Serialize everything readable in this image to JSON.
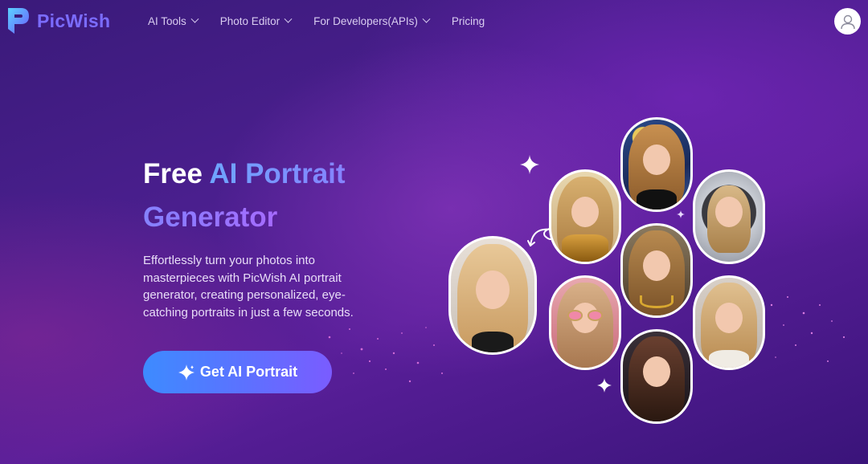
{
  "brand": {
    "name": "PicWish",
    "accent": "#7b6cff"
  },
  "nav": {
    "items": [
      {
        "label": "AI Tools",
        "dropdown": true
      },
      {
        "label": "Photo Editor",
        "dropdown": true
      },
      {
        "label": "For Developers(APIs)",
        "dropdown": true
      },
      {
        "label": "Pricing",
        "dropdown": false
      }
    ],
    "user_icon": "user-icon"
  },
  "hero": {
    "title_part1": "Free ",
    "title_part2": "AI Portrait Generator",
    "description": "Effortlessly turn your photos into masterpieces with PicWish AI portrait generator, creating personalized, eye-catching portraits in just a few seconds.",
    "cta_label": "Get AI Portrait",
    "cta_icon": "sparkle-icon"
  },
  "gallery": {
    "portraits": [
      {
        "style": "starry-night"
      },
      {
        "style": "golden-armor"
      },
      {
        "style": "astronaut"
      },
      {
        "style": "natural-blonde"
      },
      {
        "style": "gold-jewelry"
      },
      {
        "style": "pink-glasses"
      },
      {
        "style": "casual-blonde"
      },
      {
        "style": "dark-hair"
      }
    ]
  }
}
